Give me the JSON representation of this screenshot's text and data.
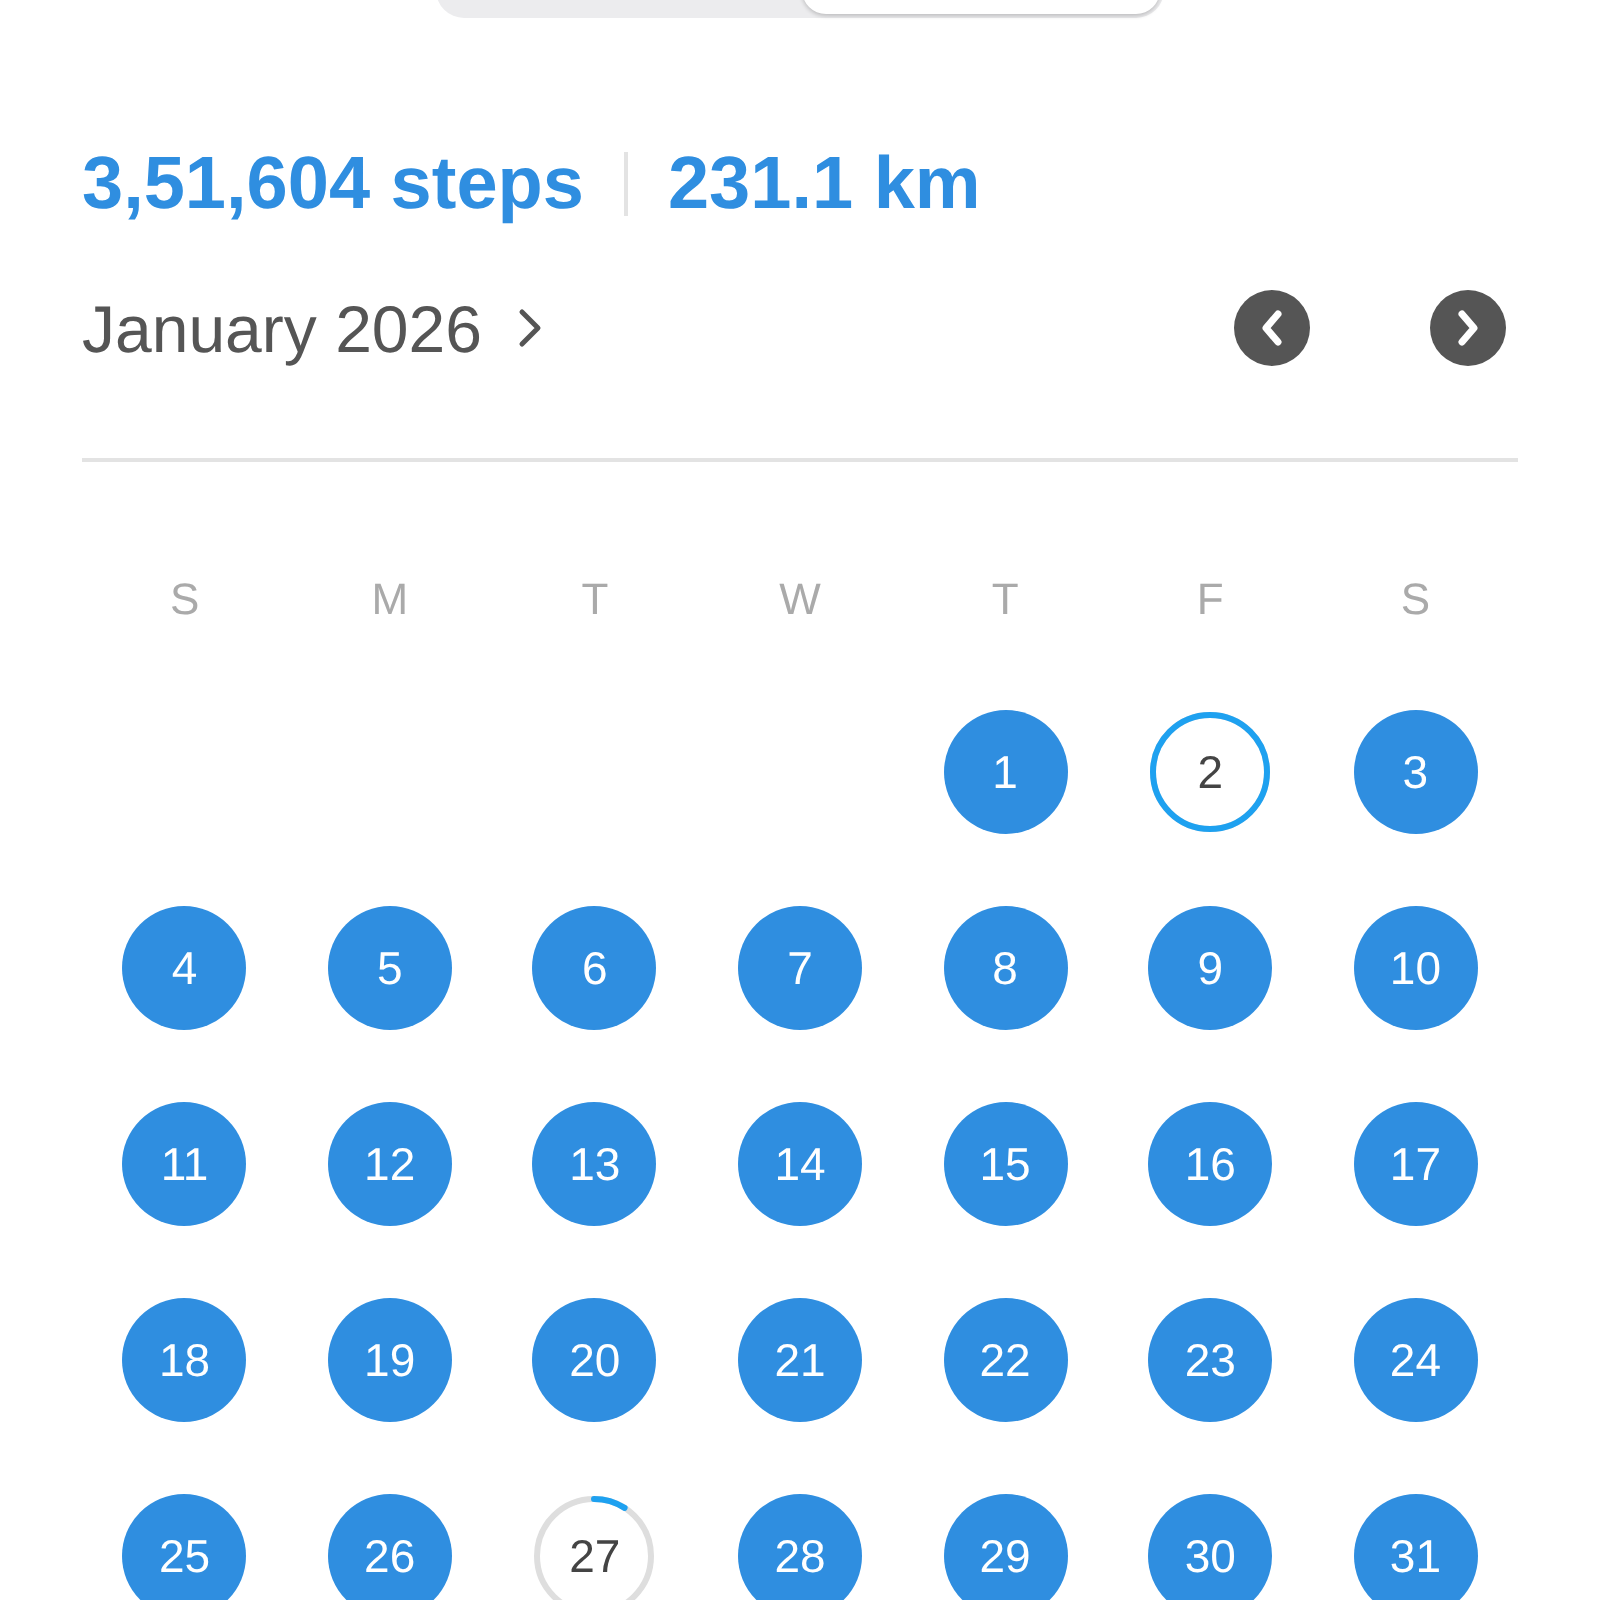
{
  "segmented_control": {
    "segments": [
      {
        "selected": false
      },
      {
        "selected": true
      }
    ]
  },
  "summary": {
    "steps": "3,51,604 steps",
    "distance": "231.1 km"
  },
  "month": {
    "title": "January 2026"
  },
  "weekdays": [
    "S",
    "M",
    "T",
    "W",
    "T",
    "F",
    "S"
  ],
  "weeks": [
    [
      {
        "kind": "blank"
      },
      {
        "kind": "blank"
      },
      {
        "kind": "blank"
      },
      {
        "kind": "blank"
      },
      {
        "day": "1",
        "kind": "met"
      },
      {
        "day": "2",
        "kind": "progress",
        "level": 1
      },
      {
        "day": "3",
        "kind": "met"
      }
    ],
    [
      {
        "day": "4",
        "kind": "met"
      },
      {
        "day": "5",
        "kind": "met"
      },
      {
        "day": "6",
        "kind": "met"
      },
      {
        "day": "7",
        "kind": "met"
      },
      {
        "day": "8",
        "kind": "met"
      },
      {
        "day": "9",
        "kind": "met"
      },
      {
        "day": "10",
        "kind": "met"
      }
    ],
    [
      {
        "day": "11",
        "kind": "met"
      },
      {
        "day": "12",
        "kind": "met"
      },
      {
        "day": "13",
        "kind": "met"
      },
      {
        "day": "14",
        "kind": "met"
      },
      {
        "day": "15",
        "kind": "met"
      },
      {
        "day": "16",
        "kind": "met"
      },
      {
        "day": "17",
        "kind": "met"
      }
    ],
    [
      {
        "day": "18",
        "kind": "met"
      },
      {
        "day": "19",
        "kind": "met"
      },
      {
        "day": "20",
        "kind": "met"
      },
      {
        "day": "21",
        "kind": "met"
      },
      {
        "day": "22",
        "kind": "met"
      },
      {
        "day": "23",
        "kind": "met"
      },
      {
        "day": "24",
        "kind": "met"
      }
    ],
    [
      {
        "day": "25",
        "kind": "met"
      },
      {
        "day": "26",
        "kind": "met"
      },
      {
        "day": "27",
        "kind": "progress",
        "level": 0.09
      },
      {
        "day": "28",
        "kind": "met"
      },
      {
        "day": "29",
        "kind": "met"
      },
      {
        "day": "30",
        "kind": "met"
      },
      {
        "day": "31",
        "kind": "met"
      }
    ]
  ]
}
